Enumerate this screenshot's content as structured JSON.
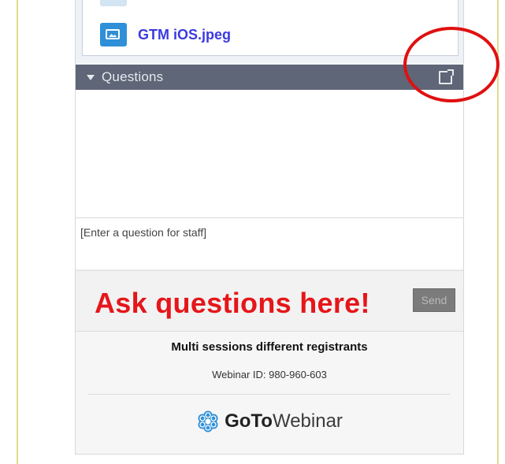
{
  "handouts": {
    "file_name": "GTM iOS.jpeg",
    "file_icon": "image-file-icon"
  },
  "questions": {
    "header_title": "Questions",
    "collapse_icon": "triangle-down-icon",
    "popout_icon": "popout-window-icon",
    "input_placeholder": "[Enter a question for staff]",
    "send_label": "Send",
    "callout_text": "Ask questions here!"
  },
  "session": {
    "title": "Multi sessions different registrants",
    "webinar_id_text": "Webinar ID: 980-960-603"
  },
  "brand": {
    "name_strong": "GoTo",
    "name_light": "Webinar",
    "logo_icon": "gotowebinar-flower-logo-icon"
  },
  "colors": {
    "header_bg": "#5e6677",
    "callout_red": "#e5161a",
    "annotation_red": "#e01010",
    "link_blue": "#3a3ae0",
    "logo_blue": "#2f8fd8"
  }
}
